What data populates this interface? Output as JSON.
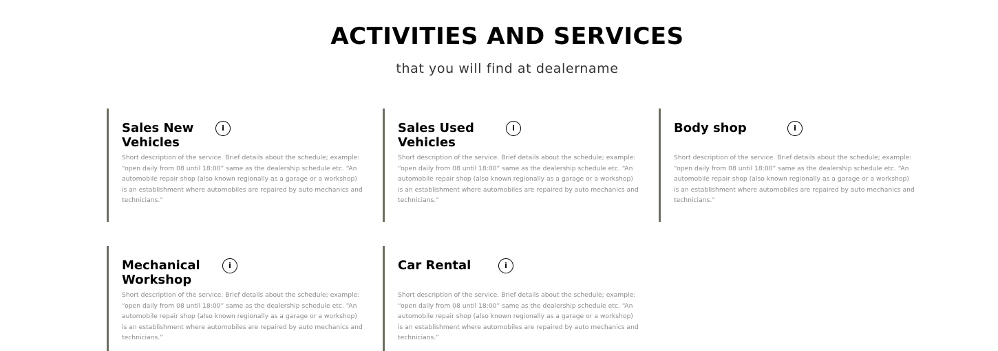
{
  "header": {
    "title": "ACTIVITIES AND SERVICES",
    "subtitle": "that you will find at dealername"
  },
  "services": [
    {
      "title": "Sales New Vehicles",
      "info_glyph": "i",
      "description": "Short description of the service. Brief details about the schedule; example: “open daily from 08 until 18:00” same as the  dealership schedule etc. “An automobile repair shop (also known regionally as a garage or a workshop) is an establishment where automobiles are repaired by auto mechanics and technicians.”"
    },
    {
      "title": "Sales Used Vehicles",
      "info_glyph": "i",
      "description": "Short description of the service. Brief details about the schedule; example: “open daily from 08 until 18:00” same as the  dealership schedule etc. “An automobile repair shop (also known regionally as a garage or a workshop) is an establishment where automobiles are repaired by auto mechanics and technicians.”"
    },
    {
      "title": "Body shop",
      "info_glyph": "i",
      "description": "Short description of the service. Brief details about the schedule; example: “open daily from 08 until 18:00” same as the  dealership schedule etc. “An automobile repair shop (also known regionally as a garage or a workshop) is an establishment where automobiles are repaired by auto mechanics and technicians.”"
    },
    {
      "title": "Mechanical Workshop",
      "info_glyph": "i",
      "description": "Short description of the service. Brief details about the schedule; example: “open daily from 08 until 18:00” same as the  dealership schedule etc. “An automobile repair shop (also known regionally as a garage or a workshop) is an establishment where automobiles are repaired by auto mechanics and technicians.”"
    },
    {
      "title": "Car Rental",
      "info_glyph": "i",
      "description": "Short description of the service. Brief details about the schedule; example: “open daily from 08 until 18:00” same as the  dealership schedule etc. “An automobile repair shop (also known regionally as a garage or a workshop) is an establishment where automobiles are repaired by auto mechanics and technicians.”"
    }
  ],
  "colors": {
    "accent_border": "#6b6e60",
    "description_text": "#8a8a8a",
    "title_text": "#000000"
  },
  "icons": {
    "info": "info-icon"
  }
}
